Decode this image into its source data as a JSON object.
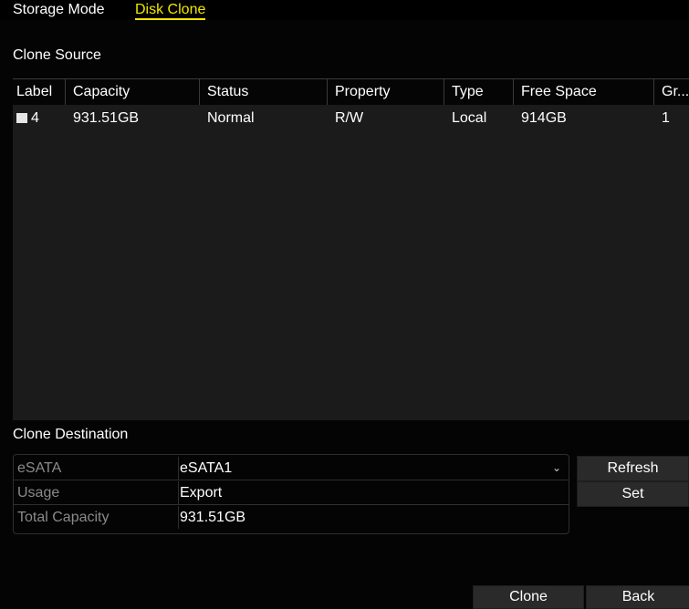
{
  "tabs": {
    "storage_mode": "Storage Mode",
    "disk_clone": "Disk Clone"
  },
  "clone_source": {
    "title": "Clone Source",
    "columns": [
      "Label",
      "Capacity",
      "Status",
      "Property",
      "Type",
      "Free Space",
      "Gr..."
    ],
    "rows": [
      {
        "label": "4",
        "capacity": "931.51GB",
        "status": "Normal",
        "property": "R/W",
        "type": "Local",
        "free_space": "914GB",
        "group": "1"
      }
    ]
  },
  "clone_destination": {
    "title": "Clone Destination",
    "esata_label": "eSATA",
    "esata_value": "eSATA1",
    "usage_label": "Usage",
    "usage_value": "Export",
    "total_capacity_label": "Total Capacity",
    "total_capacity_value": "931.51GB"
  },
  "buttons": {
    "refresh": "Refresh",
    "set": "Set",
    "clone": "Clone",
    "back": "Back"
  },
  "icons": {
    "dropdown": "chevron-down-icon",
    "checkbox": "checkbox-icon"
  },
  "colors": {
    "active_tab": "#f2e600",
    "background": "#040404",
    "panel": "#1b1b1b",
    "button": "#2a2a2a"
  }
}
